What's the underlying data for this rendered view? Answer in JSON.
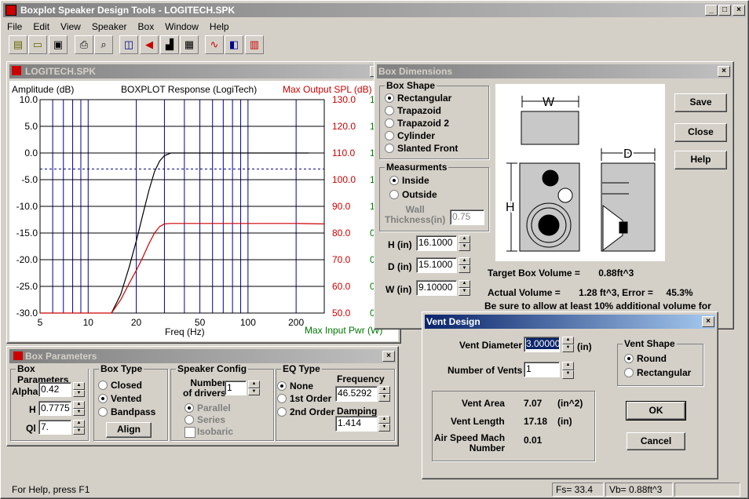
{
  "app": {
    "title": "Boxplot Speaker Design Tools - LOGITECH.SPK",
    "menu": [
      "File",
      "Edit",
      "View",
      "Speaker",
      "Box",
      "Window",
      "Help"
    ],
    "toolbar_icons": [
      "new-file-icon",
      "open-folder-icon",
      "save-disk-icon",
      "print-icon",
      "print-preview-icon",
      "speaker-pair-icon",
      "speaker-icon",
      "box-icon",
      "chart-grid-icon",
      "response-curve-icon",
      "vent-box-icon",
      "enclosure-icon"
    ]
  },
  "chart_window": {
    "title": "LOGITECH.SPK",
    "left_axis_title": "Amplitude (dB)",
    "chart_title": "BOXPLOT Response (LogiTech)",
    "right_axis_title": "Max Output SPL (dB)",
    "xlabel": "Freq (Hz)",
    "right_bottom_label": "Max Input Pwr (W)"
  },
  "chart_data": {
    "type": "line",
    "title": "BOXPLOT Response (LogiTech)",
    "xlabel": "Freq (Hz)",
    "ylabel": "Amplitude (dB)",
    "x_scale": "log",
    "xlim": [
      5,
      300
    ],
    "ylim": [
      -30,
      10
    ],
    "x_ticks": [
      "5",
      "10",
      "20",
      "50",
      "100",
      "200"
    ],
    "y_ticks": [
      "10.0",
      "5.0",
      "0.0",
      "-5.0",
      "-10.0",
      "-15.0",
      "-20.0",
      "-25.0",
      "-30.0"
    ],
    "y2_label": "Max Output SPL (dB)",
    "y2_ticks": [
      "130.0",
      "120.0",
      "110.0",
      "100.0",
      "90.0",
      "80.0",
      "70.0",
      "60.0",
      "50.0"
    ],
    "y3_label": "Max Input Pwr (W)",
    "y3_ticks": [
      "1",
      "1",
      "1",
      "1",
      "1",
      "0",
      "0",
      "0",
      "0"
    ],
    "reference_line_y": -3,
    "series": [
      {
        "color": "#000000",
        "x": [
          14,
          16,
          18,
          20,
          22,
          24,
          26,
          28,
          30,
          33,
          40,
          60,
          100,
          200,
          240
        ],
        "y": [
          -30,
          -26.5,
          -21.5,
          -16.5,
          -11.5,
          -7,
          -3.5,
          -1.5,
          -0.5,
          0,
          0,
          0,
          0,
          0,
          0
        ]
      },
      {
        "color": "#cc0000",
        "x": [
          5,
          14,
          16,
          18,
          20,
          22,
          24,
          26,
          28,
          30,
          33,
          40,
          60,
          100,
          200,
          300
        ],
        "y": [
          -30,
          -30,
          -27.5,
          -24.5,
          -22,
          -19.5,
          -17,
          -15,
          -13.8,
          -13.3,
          -13.2,
          -13.2,
          -13.2,
          -13.2,
          -13.2,
          -13.3
        ]
      }
    ]
  },
  "box_params": {
    "title": "Box Parameters",
    "group_params": "Box Parameters",
    "alpha_label": "Alpha",
    "alpha": "0.42",
    "h_label": "H",
    "h": "0.7775",
    "ql_label": "Ql",
    "ql": "7.",
    "group_type": "Box Type",
    "closed": "Closed",
    "vented": "Vented",
    "bandpass": "Bandpass",
    "align": "Align",
    "group_config": "Speaker Config",
    "num_drivers_label": "Number\nof drivers",
    "num_drivers": "1",
    "parallel": "Parallel",
    "series": "Series",
    "isobaric": "Isobaric",
    "group_eq": "EQ Type",
    "none": "None",
    "first": "1st Order",
    "second": "2nd Order",
    "frequency_label": "Frequency",
    "frequency": "46.5292",
    "damping_label": "Damping",
    "damping": "1.414"
  },
  "box_dims": {
    "title": "Box Dimensions",
    "shape_group": "Box Shape",
    "shapes": [
      "Rectangular",
      "Trapazoid",
      "Trapazoid 2",
      "Cylinder",
      "Slanted Front"
    ],
    "meas_group": "Measurments",
    "inside": "Inside",
    "outside": "Outside",
    "wall_label": "Wall\nThickness(in)",
    "wall": "0.75",
    "h_label": "H (in)",
    "h": "16.1000",
    "d_label": "D (in)",
    "d": "15.1000",
    "w_label": "W (in)",
    "w": "9.10000",
    "diagram_w": "W",
    "diagram_h": "H",
    "diagram_d": "D",
    "save": "Save",
    "close": "Close",
    "help": "Help",
    "target": "Target Box Volume =       0.88ft^3",
    "actual": "Actual Volume =       1.28 ft^3, Error =     45.3%",
    "note": "Be sure to allow at least 10% additional volume for"
  },
  "vent": {
    "title": "Vent Design",
    "diam_label": "Vent Diameter",
    "diam": "3.00000",
    "diam_unit": "(in)",
    "num_label": "Number of Vents",
    "num": "1",
    "shape_group": "Vent Shape",
    "round": "Round",
    "rect": "Rectangular",
    "area_label": "Vent Area",
    "area": "7.07",
    "area_unit": "(in^2)",
    "len_label": "Vent Length",
    "len": "17.18",
    "len_unit": "(in)",
    "mach_label": "Air Speed Mach\nNumber",
    "mach": "0.01",
    "ok": "OK",
    "cancel": "Cancel"
  },
  "status": {
    "help": "For Help, press F1",
    "fs": "Fs= 33.4",
    "vb": "Vb= 0.88ft^3"
  }
}
